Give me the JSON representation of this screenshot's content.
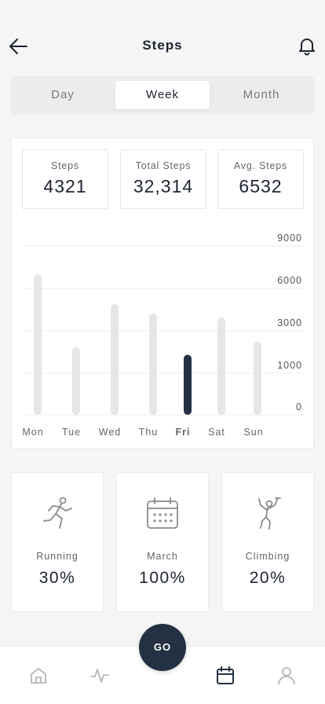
{
  "header": {
    "title": "Steps",
    "back_icon": "arrow-left-icon",
    "notification_icon": "bell-icon"
  },
  "segments": {
    "tabs": [
      {
        "label": "Day",
        "active": false
      },
      {
        "label": "Week",
        "active": true
      },
      {
        "label": "Month",
        "active": false
      }
    ]
  },
  "stats": [
    {
      "label": "Steps",
      "value": "4321"
    },
    {
      "label": "Total Steps",
      "value": "32,314"
    },
    {
      "label": "Avg. Steps",
      "value": "6532"
    }
  ],
  "chart_data": {
    "type": "bar",
    "categories": [
      "Mon",
      "Tue",
      "Wed",
      "Thu",
      "Fri",
      "Sat",
      "Sun"
    ],
    "values": [
      7500,
      3600,
      5900,
      5400,
      3200,
      5200,
      3900
    ],
    "highlighted": "Fri",
    "y_ticks": [
      "9000",
      "6000",
      "3000",
      "1000",
      "0"
    ],
    "ylim": [
      0,
      9000
    ],
    "grid": true,
    "colors": {
      "bar": "#e6e6e6",
      "highlight": "#243142",
      "grid": "#ededed"
    }
  },
  "activities": [
    {
      "icon": "running-person-icon",
      "label": "Running",
      "value": "30%"
    },
    {
      "icon": "calendar-icon",
      "label": "March",
      "value": "100%"
    },
    {
      "icon": "climbing-person-icon",
      "label": "Climbing",
      "value": "20%"
    }
  ],
  "nav": {
    "go_label": "GO",
    "items": [
      {
        "icon": "home-icon",
        "active": false
      },
      {
        "icon": "activity-icon",
        "active": false
      },
      {
        "icon": "calendar-icon",
        "active": true
      },
      {
        "icon": "profile-icon",
        "active": false
      }
    ],
    "colors": {
      "active": "#243142",
      "inactive": "#b5b5b5"
    }
  }
}
